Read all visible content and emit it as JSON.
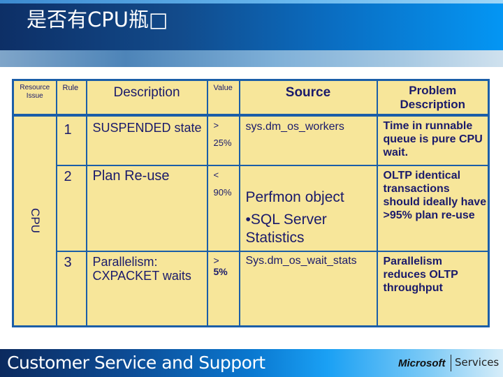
{
  "slide": {
    "title": "是否有CPU瓶□"
  },
  "table": {
    "headers": {
      "resource_issue": "Resource Issue",
      "rule": "Rule",
      "description": "Description",
      "value": "Value",
      "source": "Source",
      "problem_description": "Problem Description"
    },
    "resource_group": "CPU",
    "rows": [
      {
        "rule": "1",
        "description": "SUSPENDED state",
        "value_op": ">",
        "value_num": "25%",
        "source": "sys.dm_os_workers",
        "problem": "Time in runnable queue is pure CPU wait."
      },
      {
        "rule": "2",
        "description": "Plan Re-use",
        "value_op": "<",
        "value_num": "90%",
        "source_line1": "Perfmon object",
        "source_line2": "•SQL Server Statistics",
        "problem": "OLTP identical transactions should ideally have >95% plan re-use"
      },
      {
        "rule": "3",
        "description": "Parallelism: CXPACKET waits",
        "value_op": ">",
        "value_num": "5%",
        "source": "Sys.dm_os_wait_stats",
        "problem": "Parallelism reduces OLTP throughput"
      }
    ]
  },
  "footer": {
    "left_text": "Customer Service and Support",
    "brand": "Microsoft",
    "brand_suffix": "Services"
  },
  "colors": {
    "table_fill": "#f7e69a",
    "table_border": "#1b5ea8",
    "table_text": "#1a1a6b"
  }
}
